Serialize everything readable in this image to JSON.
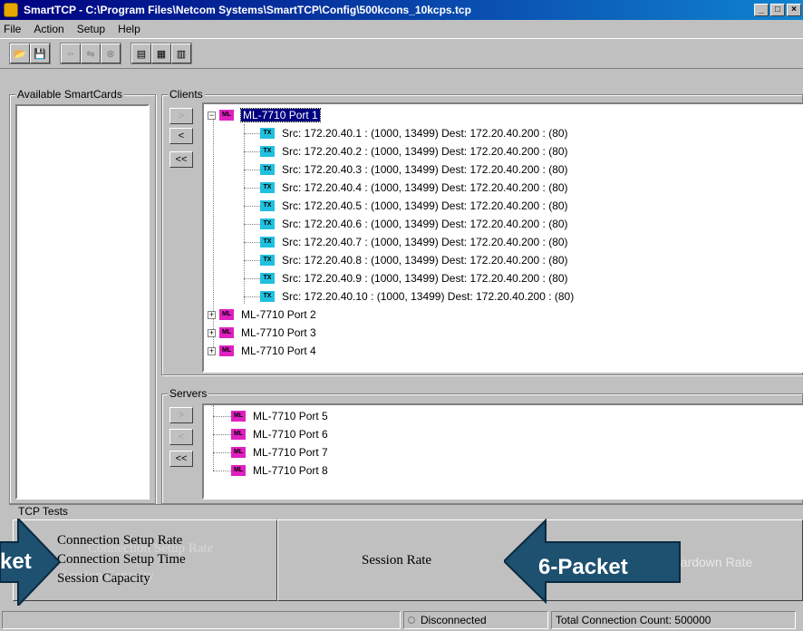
{
  "window": {
    "title": "SmartTCP - C:\\Program Files\\Netcom Systems\\SmartTCP\\Config\\500kcons_10kcps.tcp",
    "min": "_",
    "max": "□",
    "close": "×"
  },
  "menu": [
    "File",
    "Action",
    "Setup",
    "Help"
  ],
  "toolbar": {
    "group1": [
      "📂",
      "💾"
    ],
    "group2": [
      "⇔",
      "⇋",
      "⊗"
    ],
    "group3": [
      "▤",
      "▦",
      "▥"
    ]
  },
  "available": {
    "label": "Available SmartCards"
  },
  "clients": {
    "label": "Clients",
    "buttons": [
      ">",
      "<",
      "<<"
    ],
    "ports": [
      {
        "expander": "−",
        "name": "ML-7710 Port 1"
      },
      {
        "expander": "+",
        "name": "ML-7710 Port 2"
      },
      {
        "expander": "+",
        "name": "ML-7710 Port 3"
      },
      {
        "expander": "+",
        "name": "ML-7710 Port 4"
      }
    ],
    "icon_ml": "ML",
    "icon_tx": "TX",
    "tx": [
      "Src: 172.20.40.1 : (1000, 13499) Dest: 172.20.40.200 : (80)",
      "Src: 172.20.40.2 : (1000, 13499) Dest: 172.20.40.200 : (80)",
      "Src: 172.20.40.3 : (1000, 13499) Dest: 172.20.40.200 : (80)",
      "Src: 172.20.40.4 : (1000, 13499) Dest: 172.20.40.200 : (80)",
      "Src: 172.20.40.5 : (1000, 13499) Dest: 172.20.40.200 : (80)",
      "Src: 172.20.40.6 : (1000, 13499) Dest: 172.20.40.200 : (80)",
      "Src: 172.20.40.7 : (1000, 13499) Dest: 172.20.40.200 : (80)",
      "Src: 172.20.40.8 : (1000, 13499) Dest: 172.20.40.200 : (80)",
      "Src: 172.20.40.9 : (1000, 13499) Dest: 172.20.40.200 : (80)",
      "Src: 172.20.40.10 : (1000, 13499) Dest: 172.20.40.200 : (80)"
    ]
  },
  "servers": {
    "label": "Servers",
    "buttons": [
      ">",
      "<",
      "<<"
    ],
    "ports": [
      "ML-7710 Port 5",
      "ML-7710 Port 6",
      "ML-7710 Port 7",
      "ML-7710 Port 8"
    ]
  },
  "tcp_tests": {
    "label": "TCP Tests",
    "left_items": [
      "Connection Setup Rate",
      "Connection Setup Time",
      "Session Capacity"
    ],
    "left_ghost": [
      "Connection Setup Rate",
      "Session Capacity"
    ],
    "middle": "Session Rate",
    "right_ghost": "eardown Rate",
    "callout_left": "ket",
    "callout_right": "6-Packet"
  },
  "status": {
    "connection": "Disconnected",
    "total": "Total Connection Count: 500000"
  }
}
